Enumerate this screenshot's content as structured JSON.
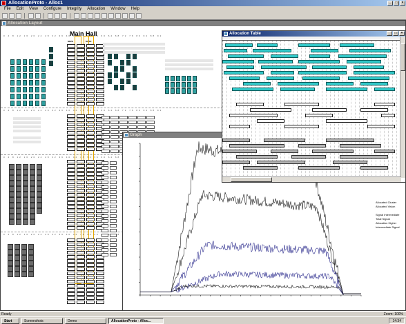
{
  "app": {
    "title": "AllocationProto - Alloc1"
  },
  "menu": [
    "File",
    "Edit",
    "View",
    "Configure",
    "Integrity",
    "Allocation",
    "Window",
    "Help"
  ],
  "layout_window": {
    "title": "Allocation Layout",
    "hall_title": "Main Hall",
    "col_a": "M0ZE",
    "col_b": "MAZE",
    "ruler": "0 4 8 12 16 20 24 28 32 36 40 44 48 52 56 60 64 68 72 76 80 84 88 92 96 100"
  },
  "alloc_window": {
    "title": "Allocation Table"
  },
  "graph_window": {
    "title": "Graph",
    "legend": [
      "Allocated Cluster",
      "Allocated Vision",
      "Signal Intermediate",
      "Total Signal",
      "Allocation Higher",
      "Intermediate Signal"
    ],
    "colors": {
      "black": "#1a1a1a",
      "blue": "#2a2a8c"
    }
  },
  "status": {
    "text": "Ready",
    "zoom": "Zoom: 100%"
  },
  "taskbar": {
    "start": "Start",
    "tasks": [
      "Screenshots",
      "Demo",
      "AllocationProto - Alloc..."
    ],
    "clock": "14:34"
  }
}
